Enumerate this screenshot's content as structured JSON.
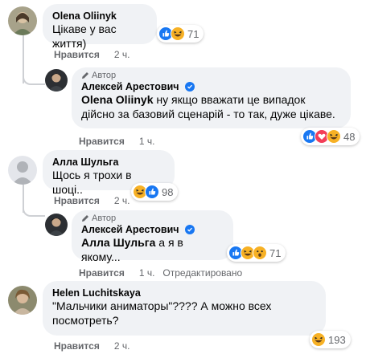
{
  "comments": [
    {
      "author": "Olena Oliinyk",
      "text": "Цікаве у вас життя)",
      "reaction_count": "71",
      "like_label": "Нравится",
      "time": "2 ч."
    },
    {
      "author_tag": "Автор",
      "author": "Алексей Арестович",
      "mention": "Olena Oliinyk",
      "text": " ну якщо вважати це випадок дійсно за базовий сценарій - то так, дуже цікаве.",
      "reaction_count": "48",
      "like_label": "Нравится",
      "time": "1 ч."
    },
    {
      "author": "Алла Шульга",
      "text": "Щось я трохи в шоці..",
      "reaction_count": "98",
      "like_label": "Нравится",
      "time": "2 ч."
    },
    {
      "author_tag": "Автор",
      "author": "Алексей Арестович",
      "mention": "Алла Шульга",
      "text": " а я в якому...",
      "reaction_count": "71",
      "like_label": "Нравится",
      "time": "1 ч.",
      "edited": "Отредактировано"
    },
    {
      "author": "Helen Luchitskaya",
      "text": "\"Мальчики аниматоры\"???? А можно всех посмотреть?",
      "reaction_count": "193",
      "like_label": "Нравится",
      "time": "2 ч."
    }
  ],
  "colors": {
    "bubble": "#f0f2f5",
    "like_blue": "#1877f2",
    "haha_yellow": "#f7b125",
    "love_red": "#f33e58",
    "meta_gray": "#65676b"
  },
  "icons": {
    "like": "like-reaction-icon",
    "haha": "haha-reaction-icon",
    "love": "love-reaction-icon",
    "verified": "verified-badge-icon",
    "author": "pencil-icon"
  }
}
